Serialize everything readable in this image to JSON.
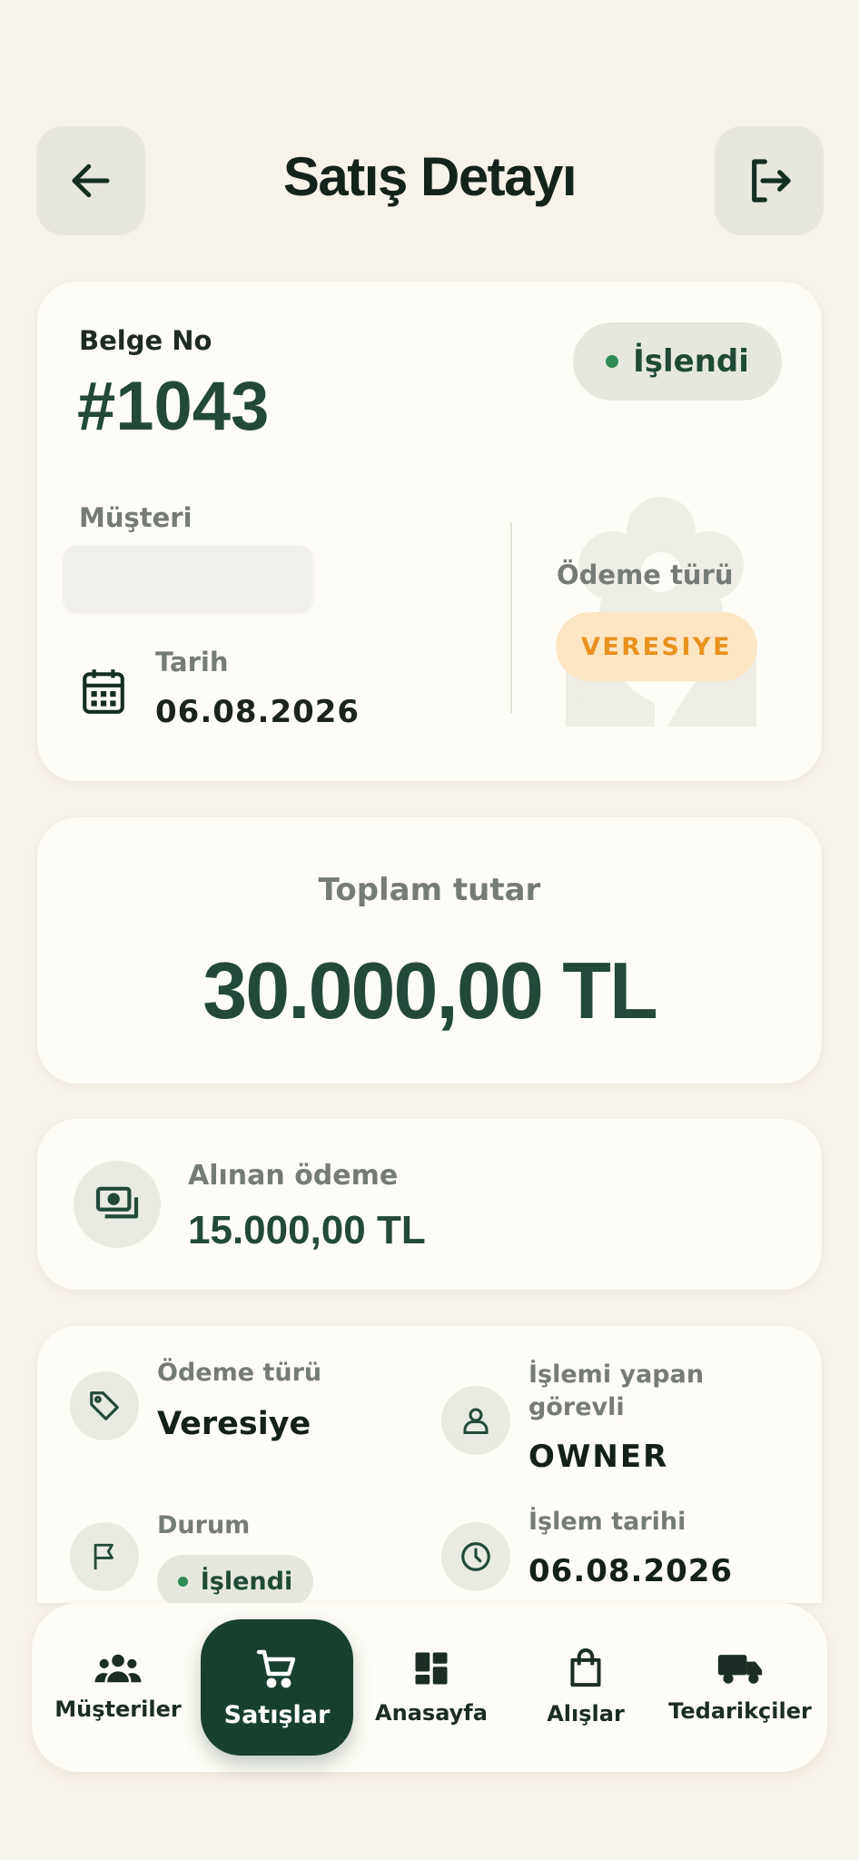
{
  "header": {
    "title": "Satış Detayı",
    "back_icon": "arrow-left-icon",
    "logout_icon": "logout-icon"
  },
  "summary": {
    "doc_label": "Belge No",
    "doc_number": "#1043",
    "status": "İşlendi",
    "customer_label": "Müşteri",
    "date_label": "Tarih",
    "date_value": "06.08.2026",
    "payment_label": "Ödeme türü",
    "payment_value": "VERESIYE"
  },
  "total": {
    "label": "Toplam tutar",
    "value": "30.000,00 TL"
  },
  "received": {
    "label": "Alınan ödeme",
    "value": "15.000,00 TL"
  },
  "details": {
    "payment_type_label": "Ödeme türü",
    "payment_type_value": "Veresiye",
    "staff_label_1": "İşlemi yapan",
    "staff_label_2": "görevli",
    "staff_value": "OWNER",
    "status_label": "Durum",
    "status_value": "İşlendi",
    "txn_date_label": "İşlem tarihi",
    "txn_date_value": "06.08.2026"
  },
  "nav": {
    "customers": "Müşteriler",
    "sales": "Satışlar",
    "home": "Anasayfa",
    "purchases": "Alışlar",
    "suppliers": "Tedarikçiler"
  },
  "colors": {
    "background": "#f7f2ea",
    "card": "#fefcf6",
    "brand_dark": "#17402f",
    "accent_green": "#2f8a55",
    "veresiye_bg": "#fde6c4",
    "veresiye_text": "#e8911f"
  }
}
